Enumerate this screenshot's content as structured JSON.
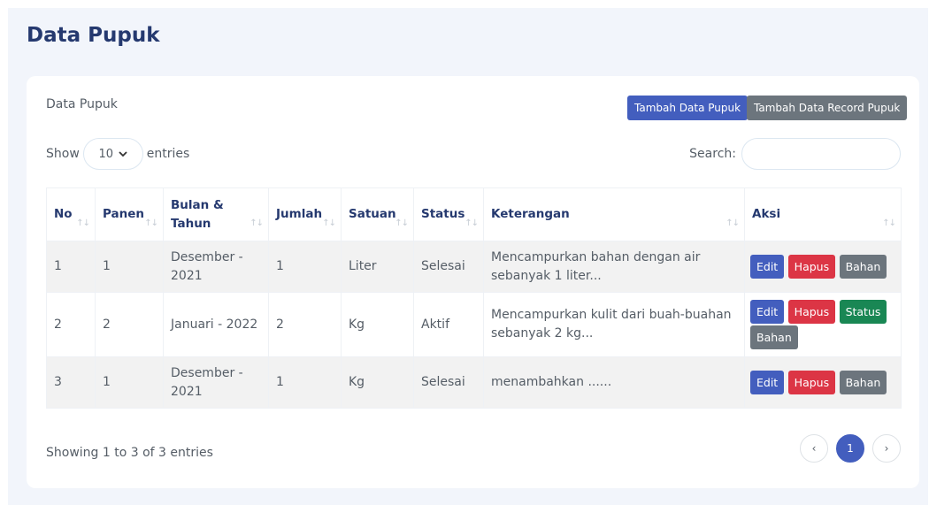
{
  "page": {
    "title": "Data Pupuk"
  },
  "card": {
    "title": "Data Pupuk",
    "add_button": "Tambah Data Pupuk",
    "add_record_button": "Tambah Data Record Pupuk"
  },
  "length": {
    "show": "Show",
    "value": "10",
    "entries": "entries"
  },
  "search": {
    "label": "Search:",
    "value": ""
  },
  "table": {
    "headers": {
      "no": "No",
      "panen": "Panen",
      "bulan_line1": "Bulan &",
      "bulan_line2": "Tahun",
      "jumlah": "Jumlah",
      "satuan": "Satuan",
      "status": "Status",
      "keterangan": "Keterangan",
      "aksi": "Aksi"
    },
    "rows": [
      {
        "no": "1",
        "panen": "1",
        "bulan_line1": "Desember -",
        "bulan_line2": "2021",
        "jumlah": "1",
        "satuan": "Liter",
        "status": "Selesai",
        "ket_line1": "Mencampurkan bahan dengan air",
        "ket_line2": "sebanyak 1 liter...",
        "actions": [
          "Edit",
          "Hapus",
          "Bahan"
        ]
      },
      {
        "no": "2",
        "panen": "2",
        "bulan": "Januari - 2022",
        "jumlah": "2",
        "satuan": "Kg",
        "status": "Aktif",
        "ket_line1": "Mencampurkan kulit dari buah-buahan",
        "ket_line2": "sebanyak 2 kg...",
        "actions": [
          "Edit",
          "Hapus",
          "Status",
          "Bahan"
        ]
      },
      {
        "no": "3",
        "panen": "1",
        "bulan_line1": "Desember -",
        "bulan_line2": "2021",
        "jumlah": "1",
        "satuan": "Kg",
        "status": "Selesai",
        "ket": "menambahkan ......",
        "actions": [
          "Edit",
          "Hapus",
          "Bahan"
        ]
      }
    ]
  },
  "footer": {
    "info": "Showing 1 to 3 of 3 entries",
    "pagination": {
      "prev": "‹",
      "current": "1",
      "next": "›"
    }
  },
  "icons": {
    "sort": "sort-arrows-icon",
    "chevron": "chevron-down-icon"
  },
  "colors": {
    "primary": "#435ebe",
    "secondary": "#6c757d",
    "danger": "#dc3545",
    "success": "#198754",
    "title": "#25396f",
    "background": "#f2f5fb"
  }
}
